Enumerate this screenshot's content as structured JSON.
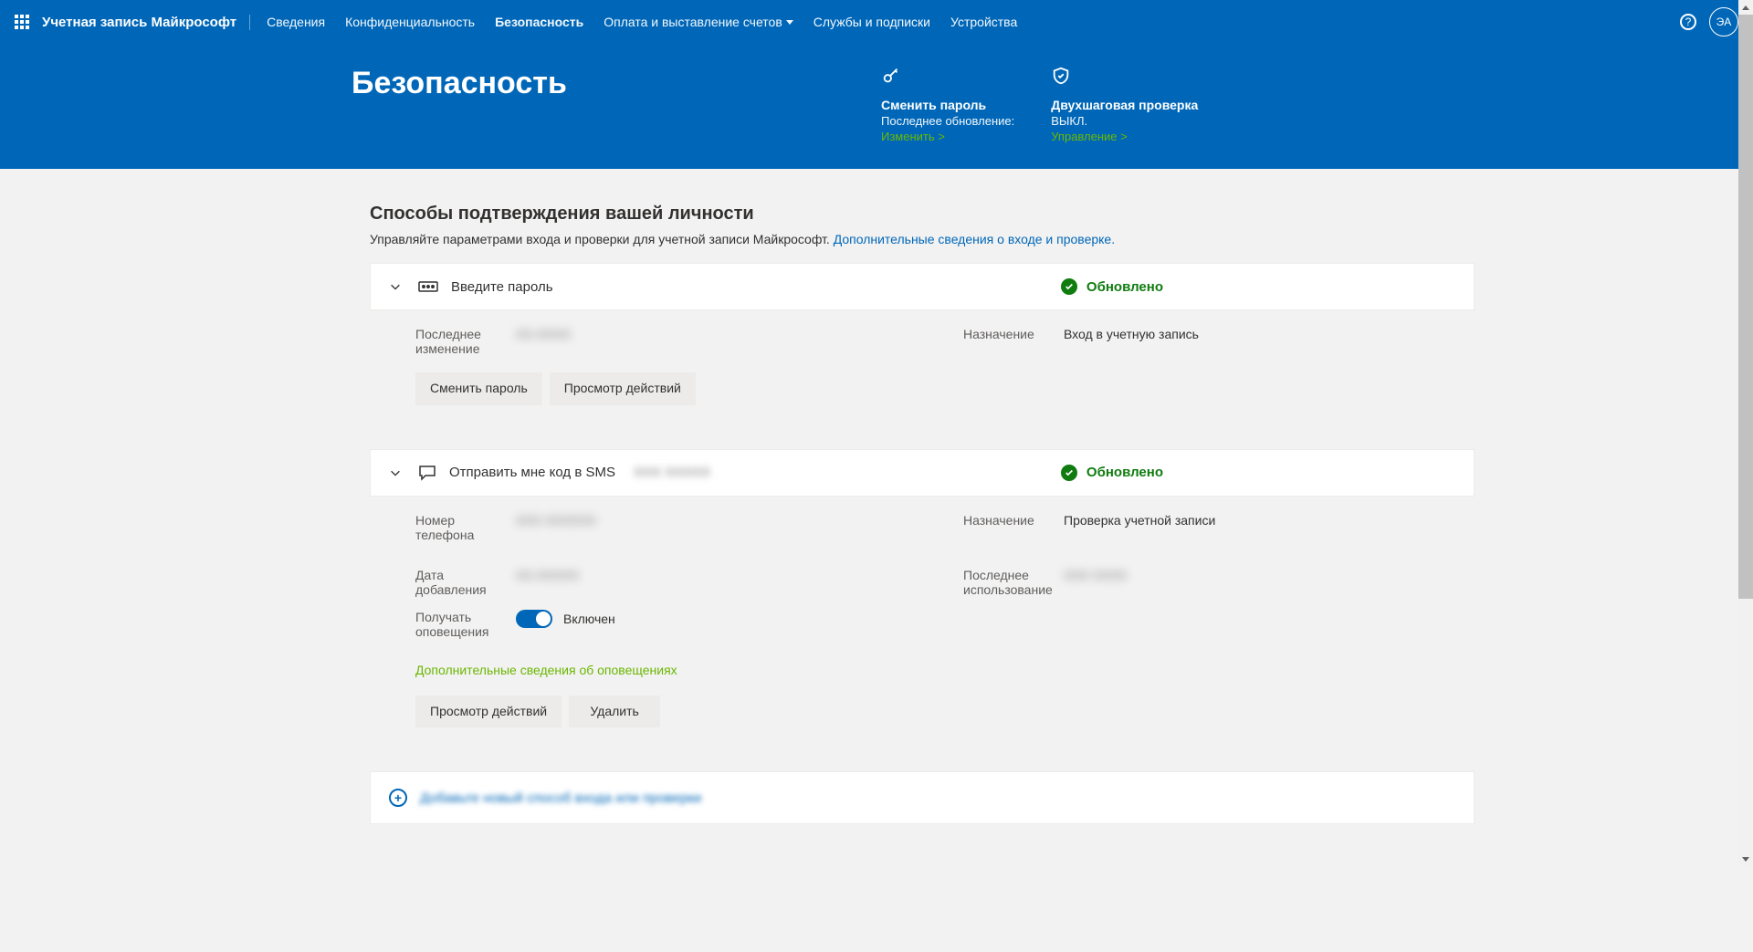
{
  "header": {
    "brand": "Учетная запись Майкрософт",
    "nav": [
      {
        "label": "Сведения",
        "active": false,
        "dropdown": false
      },
      {
        "label": "Конфиденциальность",
        "active": false,
        "dropdown": false
      },
      {
        "label": "Безопасность",
        "active": true,
        "dropdown": false
      },
      {
        "label": "Оплата и выставление счетов",
        "active": false,
        "dropdown": true
      },
      {
        "label": "Службы и подписки",
        "active": false,
        "dropdown": false
      },
      {
        "label": "Устройства",
        "active": false,
        "dropdown": false
      }
    ],
    "avatar_initials": "ЭА"
  },
  "hero": {
    "title": "Безопасность",
    "cards": [
      {
        "title": "Сменить пароль",
        "sub": "Последнее обновление:",
        "sub_value": "",
        "link": "Изменить >"
      },
      {
        "title": "Двухшаговая проверка",
        "sub": "ВЫКЛ.",
        "link": "Управление >"
      }
    ]
  },
  "section": {
    "title": "Способы подтверждения вашей личности",
    "desc_prefix": "Управляйте параметрами входа и проверки для учетной записи Майкрософт. ",
    "desc_link": "Дополнительные сведения о входе и проверке."
  },
  "methods": [
    {
      "title": "Введите пароль",
      "status": "Обновлено",
      "phone_masked": "",
      "body": {
        "left": [
          {
            "label": "Последнее изменение",
            "value": "XX.XXXX",
            "blurred": true
          }
        ],
        "right": [
          {
            "label": "Назначение",
            "value": "Вход в учетную запись",
            "blurred": false
          }
        ],
        "buttons": [
          "Сменить пароль",
          "Просмотр действий"
        ]
      }
    },
    {
      "title": "Отправить мне код в SMS",
      "status": "Обновлено",
      "phone_masked": "XXX XXXXX",
      "body": {
        "left": [
          {
            "label": "Номер телефона",
            "value": "XXX XXXXXX",
            "blurred": true
          },
          {
            "label": "Дата добавления",
            "value": "XX.XXXXX",
            "blurred": true
          }
        ],
        "right": [
          {
            "label": "Назначение",
            "value": "Проверка учетной записи",
            "blurred": false
          },
          {
            "label": "Последнее использование",
            "value": "XXX XXXX",
            "blurred": true
          }
        ],
        "toggle": {
          "label": "Получать оповещения",
          "state_label": "Включен"
        },
        "green_link": "Дополнительные сведения об оповещениях",
        "buttons": [
          "Просмотр действий",
          "Удалить"
        ]
      }
    }
  ],
  "add_row": {
    "label": "Добавьте новый способ входа или проверки"
  }
}
